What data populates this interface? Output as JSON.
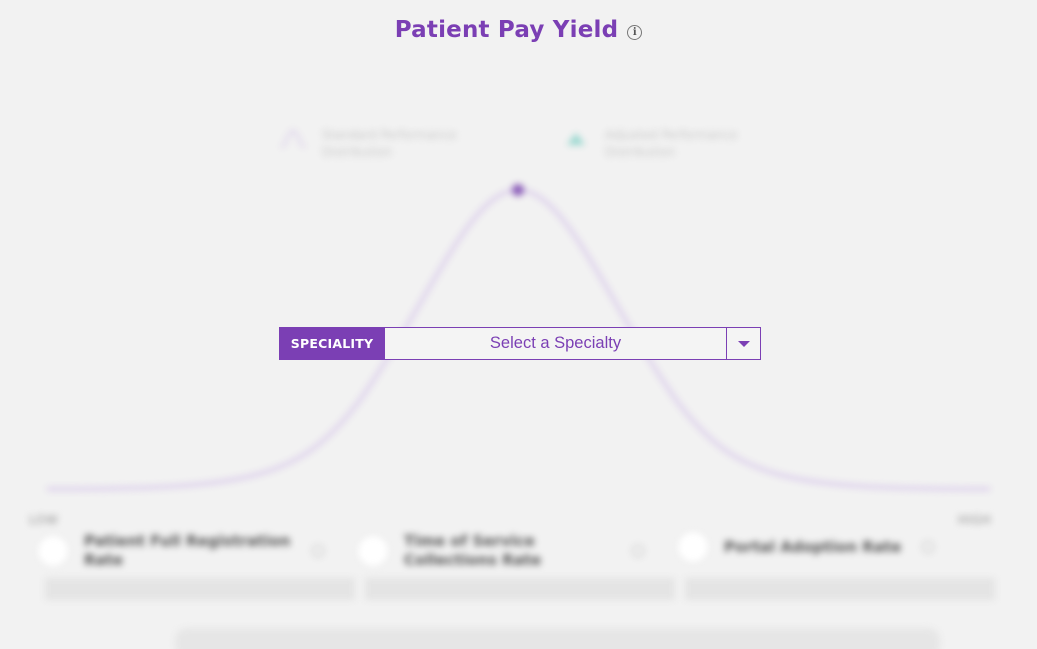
{
  "title": "Patient Pay Yield",
  "title_info_icon": "info-icon",
  "accent_color": "#7b3fb4",
  "legend": [
    {
      "label": "Standard Performance Distribution",
      "icon": "bell-curve-icon"
    },
    {
      "label": "Adjusted Performance Distribution",
      "icon": "triangle-marker-icon"
    }
  ],
  "axis": {
    "low": "LOW",
    "high": "HIGH"
  },
  "metrics": [
    {
      "label": "Patient Full Registration Rate",
      "icon": "info-icon"
    },
    {
      "label": "Time of Service Collections Rate",
      "icon": "info-icon"
    },
    {
      "label": "Portal Adoption Rate",
      "icon": "info-icon"
    }
  ],
  "speciality": {
    "tag": "SPECIALITY",
    "value": "Select a Specialty",
    "icon": "caret-down-icon"
  }
}
